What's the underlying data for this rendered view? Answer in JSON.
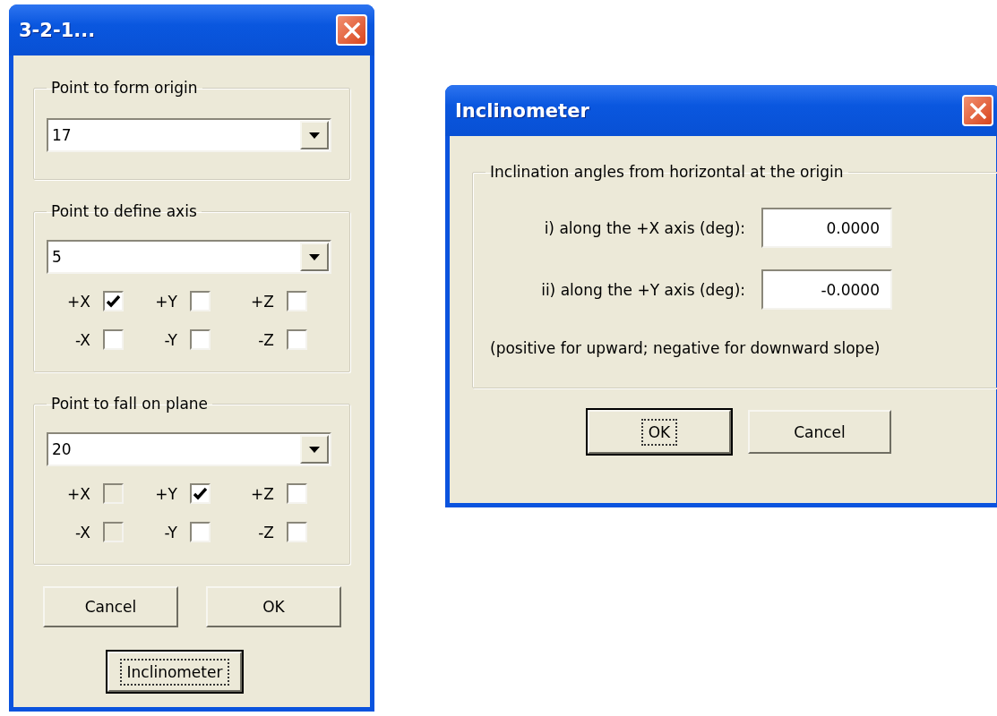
{
  "setup_dialog": {
    "title": "3-2-1...",
    "groups": [
      {
        "legend": "Point to form origin",
        "combo_value": "17"
      },
      {
        "legend": "Point to define axis",
        "combo_value": "5",
        "checkboxes": [
          {
            "label": "+X",
            "checked": true,
            "disabled": false
          },
          {
            "label": "+Y",
            "checked": false,
            "disabled": false
          },
          {
            "label": "+Z",
            "checked": false,
            "disabled": false
          },
          {
            "label": "-X",
            "checked": false,
            "disabled": false
          },
          {
            "label": "-Y",
            "checked": false,
            "disabled": false
          },
          {
            "label": "-Z",
            "checked": false,
            "disabled": false
          }
        ]
      },
      {
        "legend": "Point to fall on plane",
        "combo_value": "20",
        "checkboxes": [
          {
            "label": "+X",
            "checked": false,
            "disabled": true
          },
          {
            "label": "+Y",
            "checked": true,
            "disabled": false
          },
          {
            "label": "+Z",
            "checked": false,
            "disabled": false
          },
          {
            "label": "-X",
            "checked": false,
            "disabled": true
          },
          {
            "label": "-Y",
            "checked": false,
            "disabled": false
          },
          {
            "label": "-Z",
            "checked": false,
            "disabled": false
          }
        ]
      }
    ],
    "buttons": [
      {
        "label": "Cancel",
        "focused": false
      },
      {
        "label": "OK",
        "focused": false
      }
    ],
    "extra_button": {
      "label": "Inclinometer",
      "focused": true
    }
  },
  "inclinometer_dialog": {
    "title": "Inclinometer",
    "legend": "Inclination angles from horizontal at the origin",
    "fields": [
      {
        "label": "i) along the +X axis (deg):",
        "value": "0.0000"
      },
      {
        "label": "ii) along the +Y axis (deg):",
        "value": "-0.0000"
      }
    ],
    "note": "(positive for upward; negative for downward slope)",
    "buttons": [
      {
        "label": "OK",
        "focused": true
      },
      {
        "label": "Cancel",
        "focused": false
      }
    ]
  }
}
